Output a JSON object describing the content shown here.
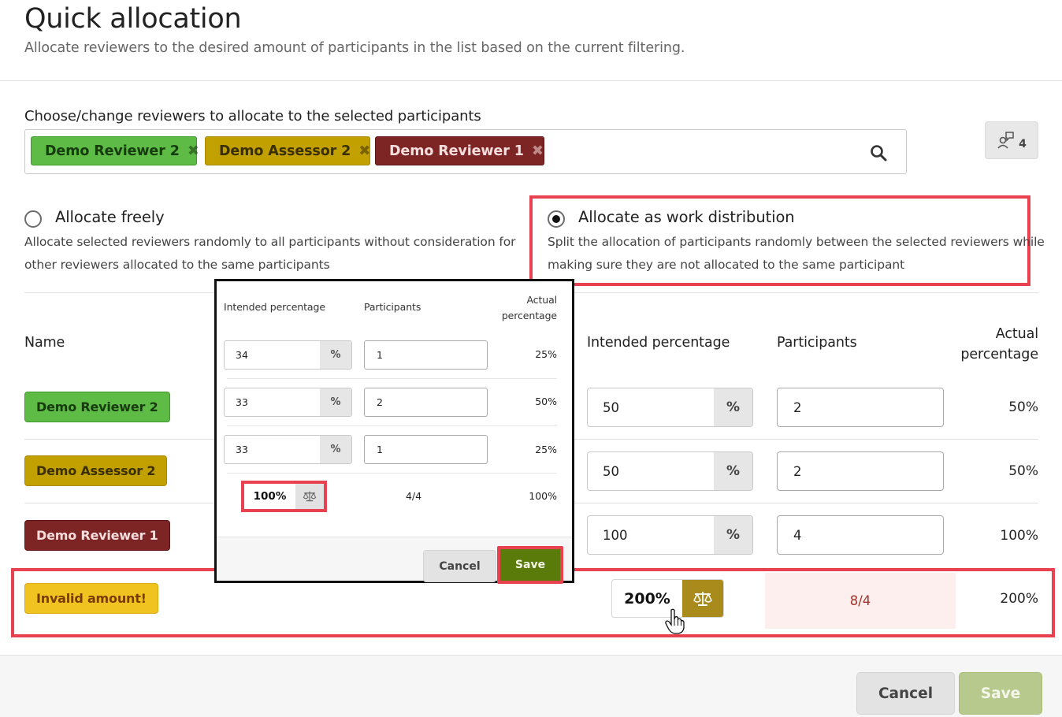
{
  "header": {
    "title": "Quick allocation",
    "subtitle": "Allocate reviewers to the desired amount of participants in the list based on the current filtering."
  },
  "chooser": {
    "label": "Choose/change reviewers to allocate to the selected participants",
    "chips": [
      {
        "label": "Demo Reviewer 2",
        "color": "#5dbb46"
      },
      {
        "label": "Demo Assessor 2",
        "color": "#c2a000"
      },
      {
        "label": "Demo Reviewer 1",
        "color": "#7d2424"
      }
    ],
    "count": "4",
    "icons": {
      "remove": "close-icon",
      "search": "search-icon",
      "count": "reviewer-count-icon"
    }
  },
  "options": {
    "free": {
      "title": "Allocate freely",
      "desc_line1": "Allocate selected reviewers randomly to all participants without consideration for",
      "desc_line2": "other reviewers allocated to the same participants",
      "selected": false
    },
    "distribution": {
      "title": "Allocate as work distribution",
      "desc_line1": "Split the allocation of participants randomly between the selected reviewers while",
      "desc_line2": "making sure they are not allocated to the same participant",
      "selected": true
    }
  },
  "table": {
    "headers": {
      "name": "Name",
      "intended": "Intended percentage",
      "participants": "Participants",
      "actual_line1": "Actual",
      "actual_line2": "percentage"
    },
    "rows": [
      {
        "name": "Demo Reviewer 2",
        "intended": "50",
        "unit": "%",
        "participants": "2",
        "actual": "50%"
      },
      {
        "name": "Demo Assessor 2",
        "intended": "50",
        "unit": "%",
        "participants": "2",
        "actual": "50%"
      },
      {
        "name": "Demo Reviewer 1",
        "intended": "100",
        "unit": "%",
        "participants": "4",
        "actual": "100%"
      }
    ],
    "summary": {
      "badge": "Invalid amount!",
      "intended_total": "200%",
      "participants_total": "8/4",
      "actual_total": "200%"
    }
  },
  "popup": {
    "headers": {
      "intended": "Intended percentage",
      "participants": "Participants",
      "actual_line1": "Actual",
      "actual_line2": "percentage"
    },
    "rows": [
      {
        "intended": "34",
        "unit": "%",
        "participants": "1",
        "actual": "25%"
      },
      {
        "intended": "33",
        "unit": "%",
        "participants": "2",
        "actual": "50%"
      },
      {
        "intended": "33",
        "unit": "%",
        "participants": "1",
        "actual": "25%"
      }
    ],
    "summary": {
      "intended_total": "100%",
      "participants_total": "4/4",
      "actual_total": "100%"
    },
    "cancel": "Cancel",
    "save": "Save"
  },
  "footer": {
    "cancel": "Cancel",
    "save": "Save"
  },
  "colors": {
    "highlight": "#e8414f",
    "balance_active": "#a88b1a",
    "save_disabled": "#b7c98d",
    "save_enabled": "#5a7a09"
  }
}
